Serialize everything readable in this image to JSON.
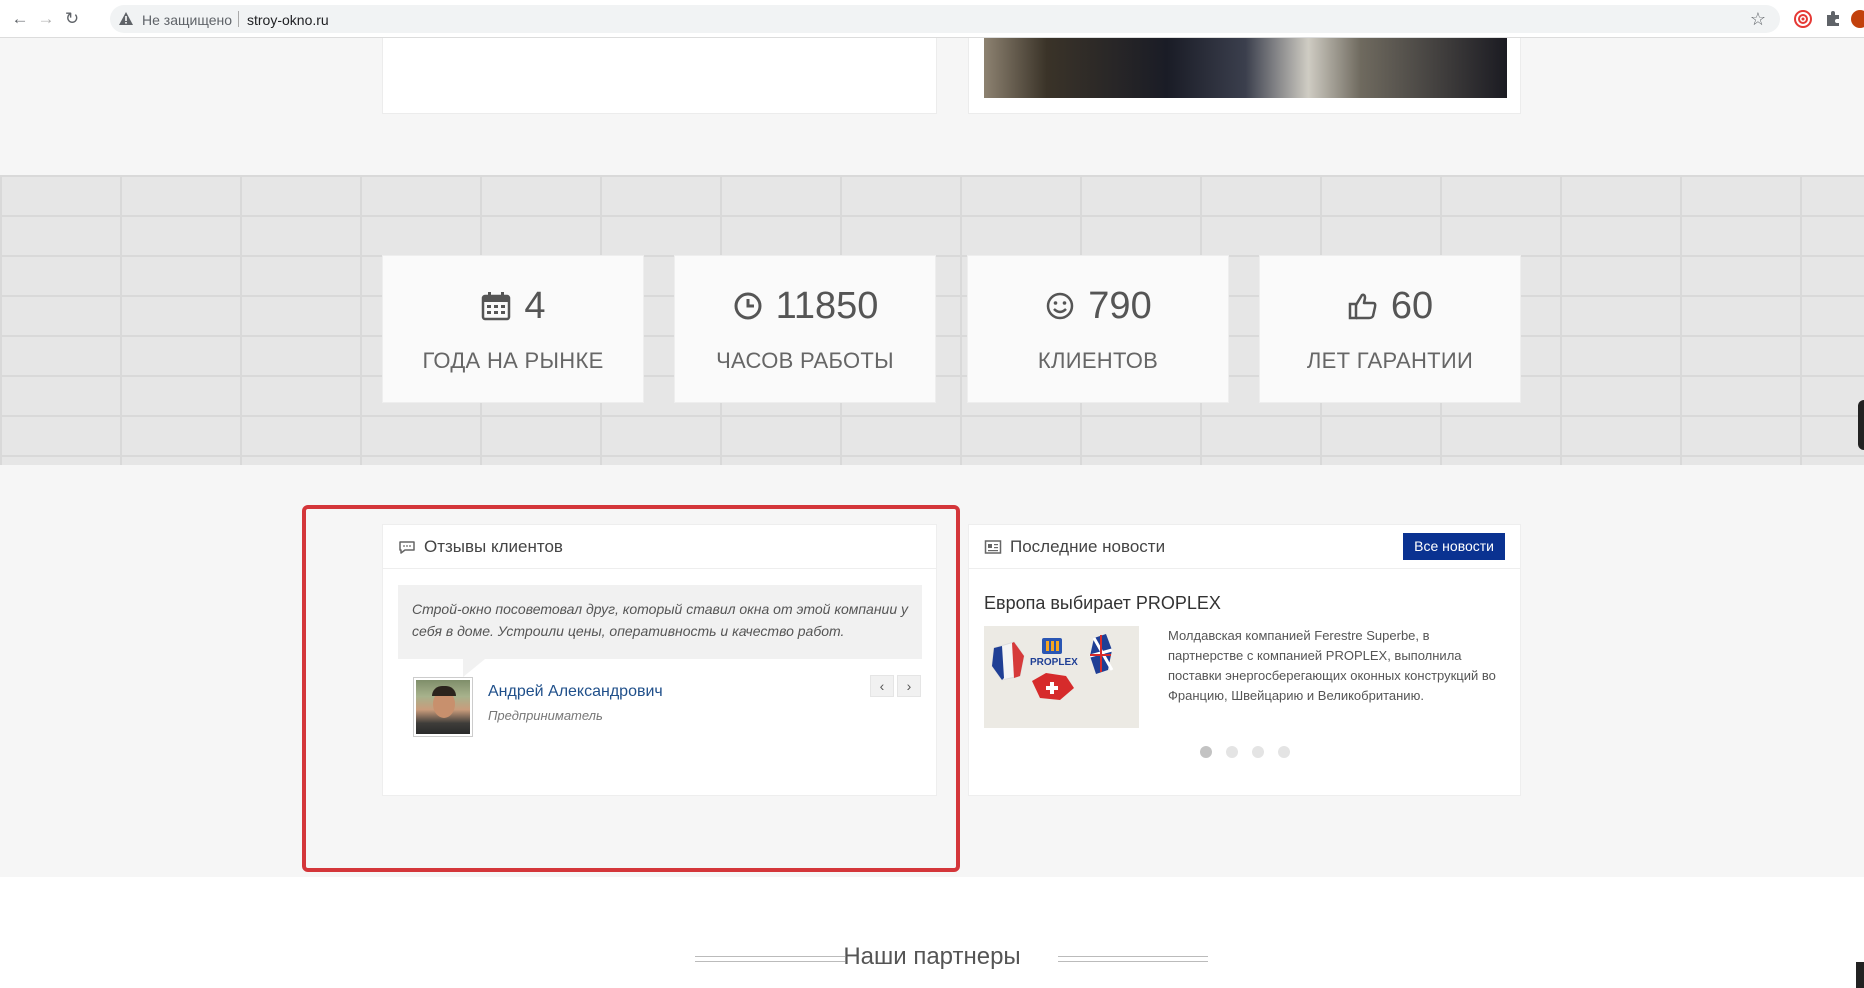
{
  "browser": {
    "security_status": "Не защищено",
    "url": "stroy-okno.ru",
    "icons": [
      "back-icon",
      "forward-icon",
      "reload-icon",
      "warning-icon",
      "bookmark-star-icon",
      "extension-icon",
      "puzzle-icon",
      "profile-icon"
    ]
  },
  "stats": [
    {
      "icon": "calendar-icon",
      "value": "4",
      "label": "ГОДА НА РЫНКЕ"
    },
    {
      "icon": "clock-icon",
      "value": "11850",
      "label": "ЧАСОВ РАБОТЫ"
    },
    {
      "icon": "smile-icon",
      "value": "790",
      "label": "КЛИЕНТОВ"
    },
    {
      "icon": "thumbs-up-icon",
      "value": "60",
      "label": "ЛЕТ ГАРАНТИИ"
    }
  ],
  "reviews": {
    "title": "Отзывы клиентов",
    "quote": "Строй-окно посоветовал друг, который ставил окна от этой компании у себя в доме. Устроили цены, оперативность и качество работ.",
    "author_name": "Андрей Александрович",
    "author_role": "Предприниматель",
    "prev_label": "‹",
    "next_label": "›"
  },
  "news": {
    "title": "Последние новости",
    "all_news_label": "Все новости",
    "headline": "Европа выбирает PROPLEX",
    "body": "Молдавская компанией Ferestre Superbe, в партнерстве с компанией PROPLEX, выполнила поставки энергосберегающих оконных конструкций во Францию, Швейцарию и Великобританию.",
    "image_logo_text": "PROPLEX",
    "slides_total": 4,
    "active_slide": 1
  },
  "partners": {
    "title": "Наши партнеры"
  },
  "colors": {
    "accent_button": "#0a3291",
    "highlight_border": "#d4363a",
    "link": "#1f4f8a"
  }
}
